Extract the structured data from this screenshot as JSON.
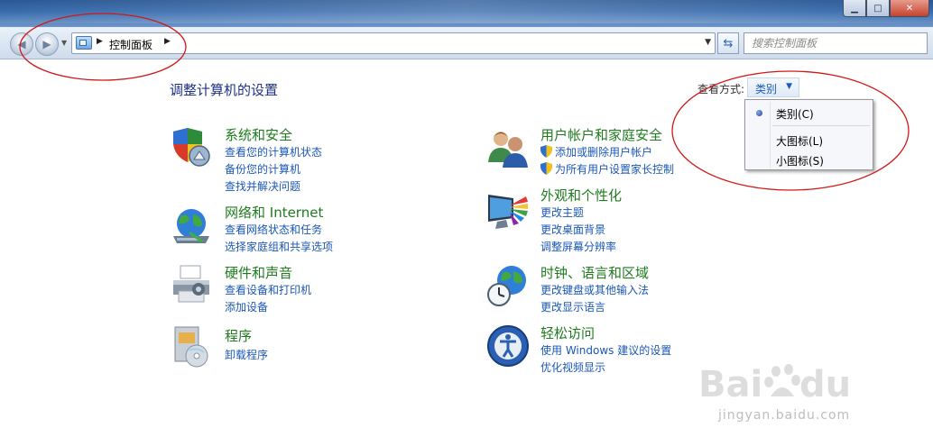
{
  "address_bar": {
    "path": "控制面板"
  },
  "search": {
    "placeholder": "搜索控制面板"
  },
  "page": {
    "title": "调整计算机的设置"
  },
  "view_by": {
    "label": "查看方式:",
    "current": "类别",
    "options": [
      {
        "label": "类别(C)",
        "selected": true
      },
      {
        "label": "大图标(L)",
        "selected": false
      },
      {
        "label": "小图标(S)",
        "selected": false
      }
    ]
  },
  "categories": {
    "system_security": {
      "title": "系统和安全",
      "icon": "security-shield-icon",
      "links": [
        "查看您的计算机状态",
        "备份您的计算机",
        "查找并解决问题"
      ]
    },
    "network": {
      "title": "网络和 Internet",
      "icon": "network-globe-icon",
      "links": [
        "查看网络状态和任务",
        "选择家庭组和共享选项"
      ]
    },
    "hardware_sound": {
      "title": "硬件和声音",
      "icon": "printer-icon",
      "links": [
        "查看设备和打印机",
        "添加设备"
      ]
    },
    "programs": {
      "title": "程序",
      "icon": "programs-disc-icon",
      "links": [
        "卸载程序"
      ]
    },
    "user_accounts": {
      "title": "用户帐户和家庭安全",
      "icon": "users-icon",
      "links": [
        "添加或删除用户帐户",
        "为所有用户设置家长控制"
      ]
    },
    "appearance": {
      "title": "外观和个性化",
      "icon": "monitor-palette-icon",
      "links": [
        "更改主题",
        "更改桌面背景",
        "调整屏幕分辨率"
      ]
    },
    "clock_region": {
      "title": "时钟、语言和区域",
      "icon": "clock-globe-icon",
      "links": [
        "更改键盘或其他输入法",
        "更改显示语言"
      ]
    },
    "ease_access": {
      "title": "轻松访问",
      "icon": "ease-of-access-icon",
      "links": [
        "使用 Windows 建议的设置",
        "优化视频显示"
      ]
    }
  },
  "watermark": {
    "logo": "Bai du 经验",
    "url": "jingyan.baidu.com"
  },
  "colors": {
    "category_title": "#1e7b1e",
    "link": "#1a57b6",
    "page_title": "#1e3287",
    "annotation": "#d01818"
  }
}
